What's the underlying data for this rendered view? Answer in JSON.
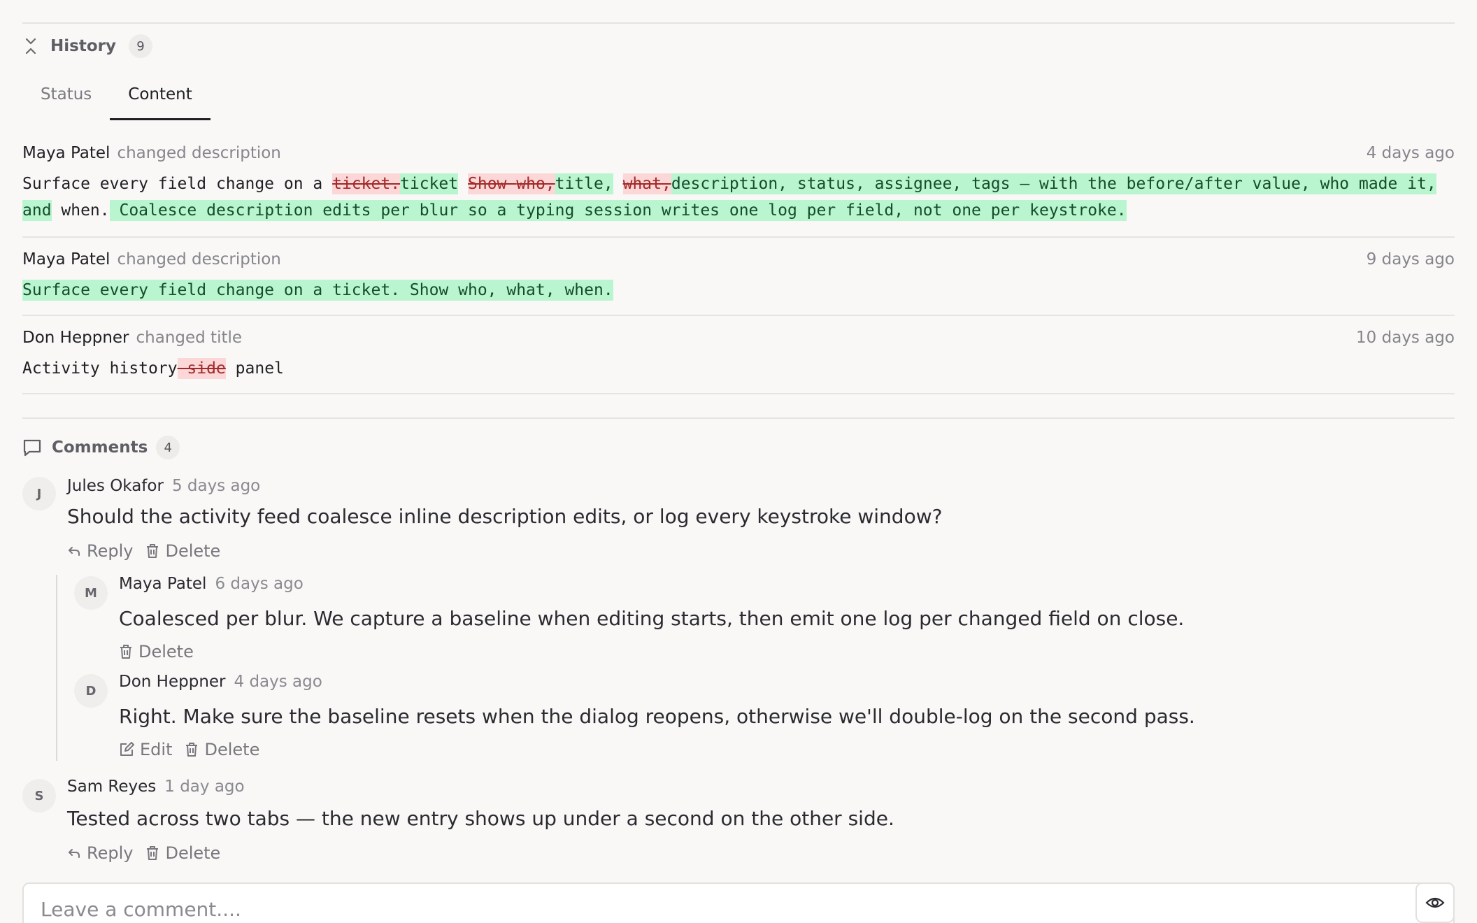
{
  "history": {
    "title": "History",
    "count": "9",
    "tabs": [
      {
        "label": "Status",
        "active": false
      },
      {
        "label": "Content",
        "active": true
      }
    ],
    "entries": [
      {
        "author": "Maya Patel",
        "action": "changed description",
        "time": "4 days ago",
        "segments": [
          {
            "type": "same",
            "text": "Surface every field change on a "
          },
          {
            "type": "del",
            "text": "ticket."
          },
          {
            "type": "ins",
            "text": "ticket"
          },
          {
            "type": "same",
            "text": " "
          },
          {
            "type": "del",
            "text": "Show "
          },
          {
            "type": "same",
            "text": " "
          },
          {
            "type": "del",
            "text": "who,"
          },
          {
            "type": "ins",
            "text": "title,"
          },
          {
            "type": "same",
            "text": " "
          },
          {
            "type": "del",
            "text": "what,"
          },
          {
            "type": "ins",
            "text": "description, status, assignee, tags — with the before/after value, who made it, and"
          },
          {
            "type": "same",
            "text": " when."
          },
          {
            "type": "ins",
            "text": " Coalesce description edits per blur so a typing session writes one log per field, not one per keystroke."
          }
        ]
      },
      {
        "author": "Maya Patel",
        "action": "changed description",
        "time": "9 days ago",
        "segments": [
          {
            "type": "ins",
            "text": "Surface every field change on a ticket. Show who, what, when."
          }
        ]
      },
      {
        "author": "Don Heppner",
        "action": "changed title",
        "time": "10 days ago",
        "segments": [
          {
            "type": "same",
            "text": "Activity history"
          },
          {
            "type": "del",
            "text": " side"
          },
          {
            "type": "same",
            "text": " panel"
          }
        ]
      }
    ]
  },
  "comments": {
    "title": "Comments",
    "count": "4",
    "items": [
      {
        "initial": "J",
        "author": "Jules Okafor",
        "time": "5 days ago",
        "body": "Should the activity feed coalesce inline description edits, or log every keystroke window?",
        "actions": [
          "Reply",
          "Delete"
        ]
      },
      {
        "initial": "M",
        "author": "Maya Patel",
        "time": "6 days ago",
        "body": "Coalesced per blur. We capture a baseline when editing starts, then emit one log per changed field on close.",
        "actions": [
          "Delete"
        ]
      },
      {
        "initial": "D",
        "author": "Don Heppner",
        "time": "4 days ago",
        "body": "Right. Make sure the baseline resets when the dialog reopens, otherwise we'll double-log on the second pass.",
        "actions": [
          "Edit",
          "Delete"
        ]
      },
      {
        "initial": "S",
        "author": "Sam Reyes",
        "time": "1 day ago",
        "body": "Tested across two tabs — the new entry shows up under a second on the other side.",
        "actions": [
          "Reply",
          "Delete"
        ]
      }
    ]
  },
  "composer": {
    "placeholder": "Leave a comment....",
    "preview_icon": "eye-icon"
  },
  "colors": {
    "insert_bg": "#b9f5cf",
    "delete_bg": "#fbd7d7",
    "background": "#f9f8f7"
  }
}
